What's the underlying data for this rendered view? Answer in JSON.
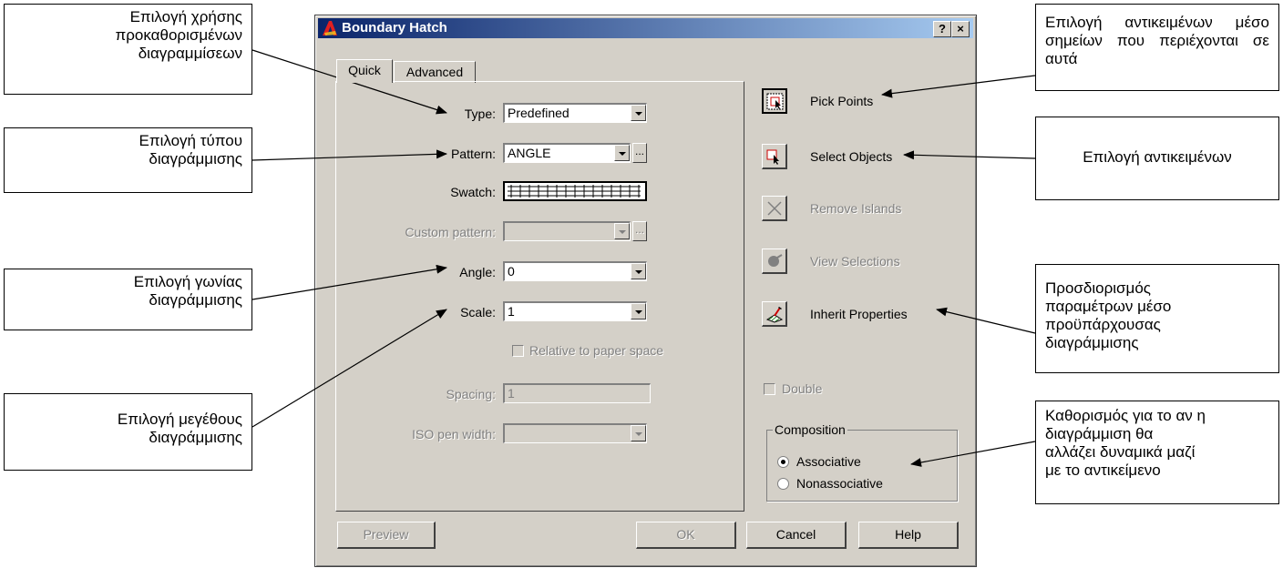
{
  "dialog": {
    "title": "Boundary Hatch",
    "help_btn": "?",
    "close_btn": "×",
    "tabs": [
      {
        "label": "Quick"
      },
      {
        "label": "Advanced"
      }
    ],
    "type": {
      "label": "Type:",
      "value": "Predefined"
    },
    "pattern": {
      "label": "Pattern:",
      "value": "ANGLE",
      "browse": "..."
    },
    "swatch": {
      "label": "Swatch:"
    },
    "custom_pattern": {
      "label": "Custom pattern:",
      "browse": "..."
    },
    "angle": {
      "label": "Angle:",
      "value": "0"
    },
    "scale": {
      "label": "Scale:",
      "value": "1"
    },
    "relative": {
      "label": "Relative to paper space"
    },
    "spacing": {
      "label": "Spacing:",
      "value": "1"
    },
    "iso": {
      "label": "ISO pen width:"
    },
    "actions": {
      "pick_points": "Pick Points",
      "select_objects": "Select Objects",
      "remove_islands": "Remove Islands",
      "view_selections": "View Selections",
      "inherit_properties": "Inherit Properties"
    },
    "double": {
      "label": "Double"
    },
    "composition": {
      "legend": "Composition",
      "associative": "Associative",
      "nonassociative": "Nonassociative",
      "selected": "Associative"
    },
    "buttons": {
      "preview": "Preview",
      "ok": "OK",
      "cancel": "Cancel",
      "help": "Help"
    }
  },
  "callouts": {
    "predefined": "Επιλογή χρήσης\nπροκαθορισμένων\nδιαγραμμίσεων",
    "pattern_type": "Επιλογή τύπου\nδιαγράμμισης",
    "angle": "Επιλογή γωνίας\nδιαγράμμισης",
    "size": "Επιλογή μεγέθους\nδιαγράμμισης",
    "pick_points": "Επιλογή αντικειμένων μέσο σημείων που περιέχονται σε αυτά",
    "select_objects": "Επιλογή αντικειμένων",
    "inherit": "Προσδιορισμός\nπαραμέτρων μέσο\nπροϋπάρχουσας\nδιαγράμμισης",
    "associative": "Καθορισμός για το αν η\nδιαγράμμιση θα\nαλλάζει δυναμικά μαζί\nμε το αντικείμενο"
  }
}
